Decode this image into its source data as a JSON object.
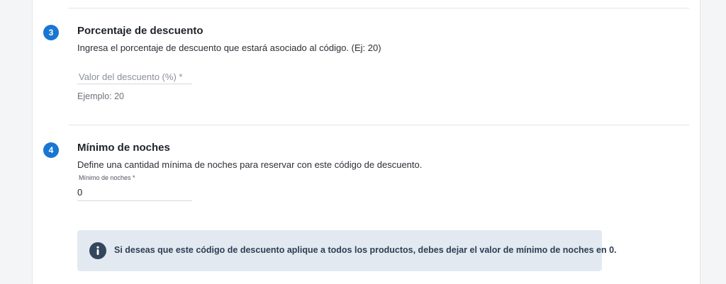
{
  "section3": {
    "step": "3",
    "title": "Porcentaje de descuento",
    "description": "Ingresa el porcentaje de descuento que estará asociado al código. (Ej: 20)",
    "field_placeholder": "Valor del descuento (%) *",
    "field_value": "",
    "helper": "Ejemplo: 20"
  },
  "section4": {
    "step": "4",
    "title": "Mínimo de noches",
    "description": "Define una cantidad mínima de noches para reservar con este código de descuento.",
    "field_label": "Mínimo de noches *",
    "field_value": "0"
  },
  "alert": {
    "icon": "info-icon",
    "text": "Si deseas que este código de descuento aplique a todos los productos, debes dejar el valor de mínimo de noches en 0."
  },
  "colors": {
    "accent": "#1976d2",
    "alert_bg": "#e2e9f1",
    "alert_text": "#2d3e52"
  }
}
